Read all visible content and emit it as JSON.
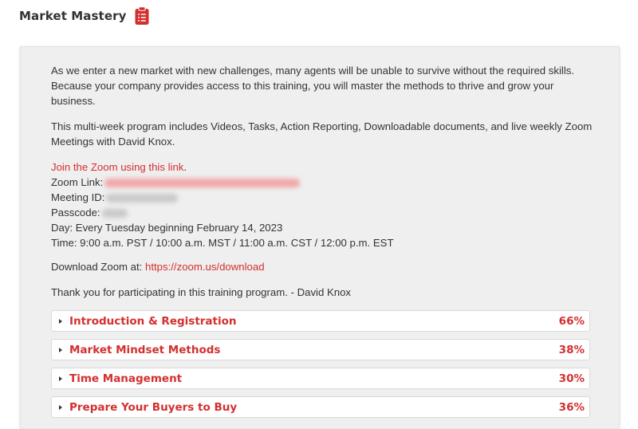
{
  "header": {
    "title": "Market Mastery",
    "icon": "clipboard-list-icon",
    "icon_color": "#d32f2f"
  },
  "content": {
    "intro": "As we enter a new market with new challenges, many agents will be unable to survive without the required skills. Because your company provides access to this training, you will master the methods to thrive and grow your business.",
    "program": "This multi-week program includes Videos, Tasks, Action Reporting, Downloadable documents, and live weekly Zoom Meetings with David Knox.",
    "join_link": "Join the Zoom using this link",
    "join_suffix": ".",
    "zoom_link_label": "Zoom Link:",
    "meeting_id_label": "Meeting ID:",
    "passcode_label": "Passcode:",
    "day": "Day: Every Tuesday beginning February 14, 2023",
    "time": "Time: 9:00 a.m. PST / 10:00 a.m. MST / 11:00 a.m. CST / 12:00 p.m. EST",
    "download_label": "Download Zoom at: ",
    "download_url": "https://zoom.us/download",
    "thanks": "Thank you for participating in this training program. - David Knox"
  },
  "modules": [
    {
      "title": "Introduction & Registration",
      "progress": "66%"
    },
    {
      "title": "Market Mindset Methods",
      "progress": "38%"
    },
    {
      "title": "Time Management",
      "progress": "30%"
    },
    {
      "title": "Prepare Your Buyers to Buy",
      "progress": "36%"
    }
  ],
  "colors": {
    "accent": "#d32f2f",
    "card_background": "#efefef",
    "text": "#333333"
  }
}
